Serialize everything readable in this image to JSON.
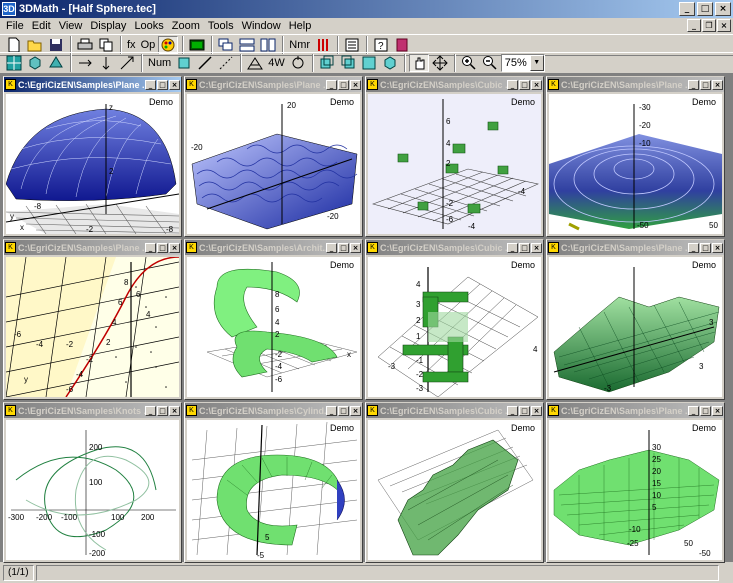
{
  "window": {
    "title": "3DMath - [Half Sphere.tec]",
    "app_icon": "3D"
  },
  "menu": [
    "File",
    "Edit",
    "View",
    "Display",
    "Looks",
    "Zoom",
    "Tools",
    "Window",
    "Help"
  ],
  "toolbar1": {
    "fx": "fx",
    "op": "Op",
    "nmr": "Nmr"
  },
  "toolbar2": {
    "num": "Num",
    "fourw": "4W",
    "zoom_value": "75%"
  },
  "windows": [
    {
      "title": "C:\\EgriCizEN\\Samples\\Plane ...",
      "demo": "Demo",
      "labels": [
        "z",
        "2",
        "-8",
        "-8",
        "-2",
        "x",
        "y"
      ]
    },
    {
      "title": "C:\\EgriCizEN\\Samples\\Plane ...",
      "demo": "Demo",
      "labels": [
        "20",
        "-20",
        "-20"
      ]
    },
    {
      "title": "C:\\EgriCizEN\\Samples\\Cubic ...",
      "demo": "Demo",
      "labels": [
        "6",
        "4",
        "2",
        "-2",
        "-4",
        "-4",
        "-6"
      ]
    },
    {
      "title": "C:\\EgriCizEN\\Samples\\Plane ...",
      "demo": "Demo",
      "labels": [
        "-30",
        "-20",
        "-10",
        "-50",
        "50"
      ]
    },
    {
      "title": "C:\\EgriCizEN\\Samples\\Plane ...",
      "demo": "",
      "labels": [
        "8",
        "6",
        "4",
        "2",
        "-6",
        "-4",
        "-2",
        "4",
        "6",
        "-2",
        "-4",
        "-6",
        "y"
      ]
    },
    {
      "title": "C:\\EgriCizEN\\Samples\\Archit...",
      "demo": "Demo",
      "labels": [
        "8",
        "6",
        "4",
        "2",
        "-2",
        "-4",
        "-6",
        "x"
      ]
    },
    {
      "title": "C:\\EgriCizEN\\Samples\\Cubic ...",
      "demo": "Demo",
      "labels": [
        "4",
        "3",
        "2",
        "1",
        "-1",
        "-2",
        "-3",
        "-3",
        "4"
      ]
    },
    {
      "title": "C:\\EgriCizEN\\Samples\\Plane ...",
      "demo": "Demo",
      "labels": [
        "3",
        "-3",
        "3"
      ]
    },
    {
      "title": "C:\\EgriCizEN\\Samples\\Knots ...",
      "demo": "",
      "labels": [
        "200",
        "100",
        "-300",
        "-200",
        "-100",
        "100",
        "200",
        "-100",
        "-200"
      ]
    },
    {
      "title": "C:\\EgriCizEN\\Samples\\Cylind...",
      "demo": "Demo",
      "labels": [
        "5",
        "-5"
      ]
    },
    {
      "title": "C:\\EgriCizEN\\Samples\\Cubic ...",
      "demo": "Demo",
      "labels": []
    },
    {
      "title": "C:\\EgriCizEN\\Samples\\Plane ...",
      "demo": "Demo",
      "labels": [
        "30",
        "25",
        "20",
        "15",
        "10",
        "5",
        "-10",
        "-25",
        "-50",
        "50"
      ]
    }
  ],
  "status": {
    "page": "(1/1)"
  }
}
